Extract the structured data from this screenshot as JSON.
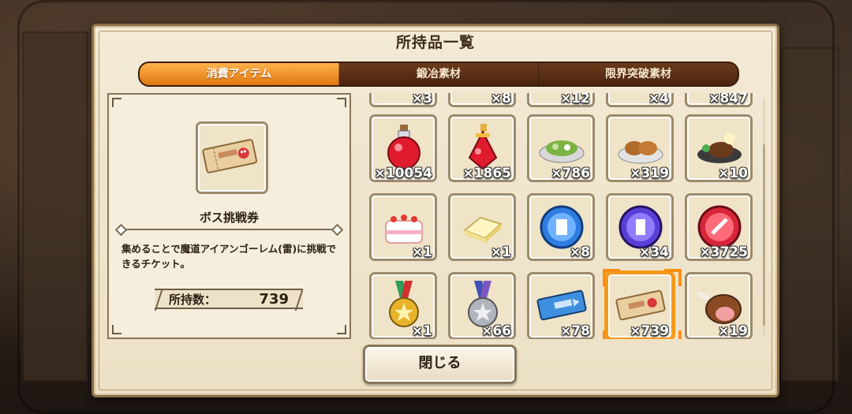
{
  "window": {
    "title": "所持品一覧"
  },
  "tabs": [
    {
      "label": "消費アイテム",
      "active": true
    },
    {
      "label": "鍛冶素材",
      "active": false
    },
    {
      "label": "限界突破素材",
      "active": false
    }
  ],
  "detail": {
    "item_name": "ボス挑戦券",
    "description": "集めることで魔道アイアンゴーレム(雷)に挑戦できるチケット。",
    "count_label": "所持数：",
    "count_value": "739"
  },
  "grid": {
    "partial_row": [
      "×3",
      "×8",
      "×12",
      "×4",
      "×847"
    ],
    "items": [
      {
        "icon": "red-potion-icon",
        "qty": "×10054"
      },
      {
        "icon": "red-elixir-icon",
        "qty": "×1865"
      },
      {
        "icon": "salad-icon",
        "qty": "×786"
      },
      {
        "icon": "fried-chicken-icon",
        "qty": "×319"
      },
      {
        "icon": "hamburg-steak-icon",
        "qty": "×10"
      },
      {
        "icon": "birthday-cake-icon",
        "qty": "×1"
      },
      {
        "icon": "butter-icon",
        "qty": "×1"
      },
      {
        "icon": "blue-coin-icon",
        "qty": "×8"
      },
      {
        "icon": "purple-coin-icon",
        "qty": "×34"
      },
      {
        "icon": "red-coin-icon",
        "qty": "×3725"
      },
      {
        "icon": "gold-medal-icon",
        "qty": "×1"
      },
      {
        "icon": "silver-medal-icon",
        "qty": "×66"
      },
      {
        "icon": "blue-ticket-icon",
        "qty": "×78"
      },
      {
        "icon": "boss-ticket-icon",
        "qty": "×739",
        "selected": true
      },
      {
        "icon": "meat-leg-icon",
        "qty": "×19"
      }
    ]
  },
  "close_button": {
    "label": "閉じる"
  },
  "colors": {
    "accent": "#f39a1b",
    "tab_active": "#e07810",
    "panel": "#f3ead6"
  }
}
